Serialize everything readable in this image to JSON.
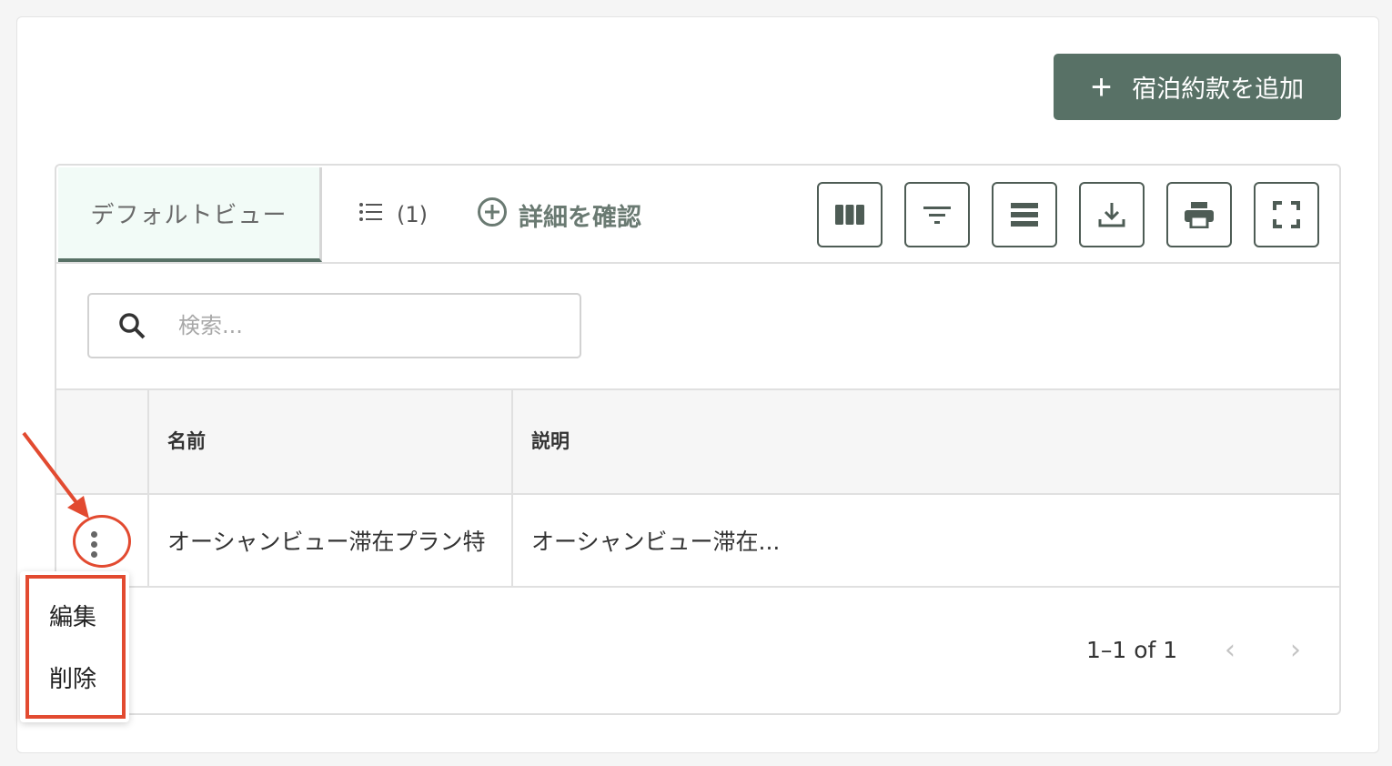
{
  "header": {
    "add_button_label": "宿泊約款を追加",
    "add_button_icon": "plus-icon"
  },
  "toolbar": {
    "tab_default_label": "デフォルトビュー",
    "tab_list_count": "(1)",
    "tab_list_icon": "list-icon",
    "tab_detail_label": "詳細を確認",
    "tab_detail_icon": "plus-circle-icon",
    "icons": [
      "columns-icon",
      "filter-icon",
      "density-icon",
      "download-icon",
      "print-icon",
      "fullscreen-icon"
    ]
  },
  "search": {
    "placeholder": "検索...",
    "icon": "search-icon"
  },
  "table": {
    "columns": [
      "名前",
      "説明"
    ],
    "rows": [
      {
        "name": "オーシャンビュー滞在プラン特",
        "description": "オーシャンビュー滞在..."
      }
    ]
  },
  "pagination": {
    "range_text": "1–1 of 1",
    "prev": "‹",
    "next": "›"
  },
  "row_menu": {
    "items": [
      "編集",
      "削除"
    ]
  },
  "colors": {
    "accent": "#587166",
    "annotation": "#e24a30"
  }
}
